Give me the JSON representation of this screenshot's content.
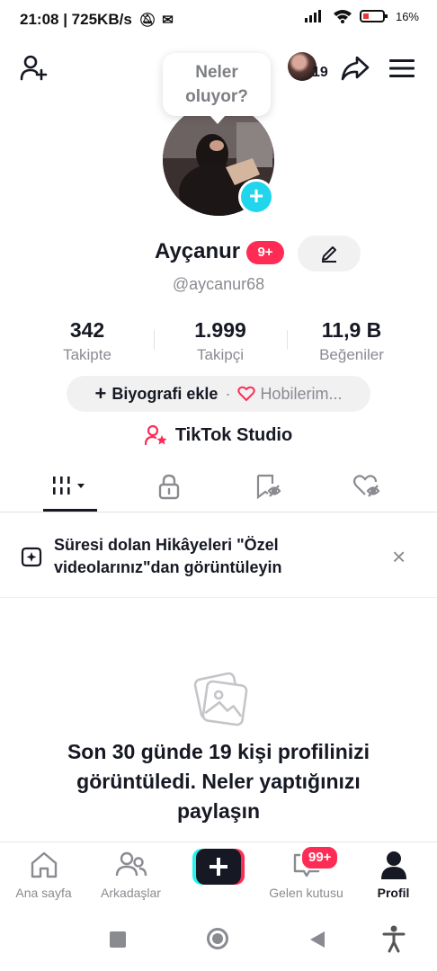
{
  "status_bar": {
    "left_text": "21:08 | 725KB/s",
    "battery": "16%",
    "icons": [
      "bell-muted-icon",
      "mail-icon",
      "signal-icon",
      "wifi-icon",
      "battery-icon"
    ]
  },
  "header": {
    "add_friend_icon": "person-add-icon",
    "story_viewers_count": "19",
    "share_icon": "share-icon",
    "menu_icon": "hamburger-menu-icon"
  },
  "bubble": {
    "text_line1": "Neler",
    "text_line2": "oluyor?"
  },
  "profile": {
    "name": "Ayçanur",
    "name_badge": "9+",
    "username": "@aycanur68"
  },
  "stats": [
    {
      "value": "342",
      "label": "Takipte"
    },
    {
      "value": "1.999",
      "label": "Takipçi"
    },
    {
      "value": "11,9 B",
      "label": "Beğeniler"
    }
  ],
  "bio": {
    "add_label": "Biyografi ekle",
    "separator": "·",
    "hobbies_label": "Hobilerim..."
  },
  "studio": {
    "label": "TikTok Studio"
  },
  "tabs": [
    {
      "icon": "grid-videos-icon",
      "active": true
    },
    {
      "icon": "lock-icon",
      "active": false
    },
    {
      "icon": "saved-icon",
      "active": false
    },
    {
      "icon": "liked-icon",
      "active": false
    }
  ],
  "notice": {
    "text": "Süresi dolan Hikâyeleri \"Özel videolarınız\"dan görüntüleyin",
    "close": "×"
  },
  "empty_state": {
    "text": "Son 30 günde 19 kişi profilinizi görüntüledi. Neler yaptığınızı paylaşın"
  },
  "bottom_nav": {
    "items": [
      {
        "label": "Ana sayfa",
        "icon": "home-icon"
      },
      {
        "label": "Arkadaşlar",
        "icon": "friends-icon"
      },
      {
        "label": "",
        "icon": "create-plus-icon"
      },
      {
        "label": "Gelen kutusu",
        "icon": "inbox-icon",
        "badge": "99+"
      },
      {
        "label": "Profil",
        "icon": "profile-icon"
      }
    ]
  },
  "colors": {
    "accent_pink": "#fe2c55",
    "accent_cyan": "#20d5ec",
    "text_primary": "#161823",
    "text_secondary": "#8a8b91"
  }
}
